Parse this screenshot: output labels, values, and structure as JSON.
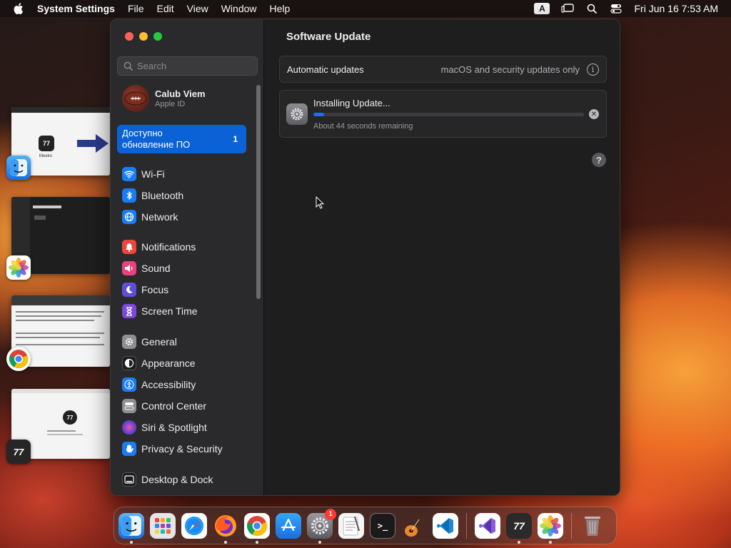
{
  "menubar": {
    "app_name": "System Settings",
    "items": [
      "File",
      "Edit",
      "View",
      "Window",
      "Help"
    ],
    "input_source": "A",
    "clock": "Fri Jun 16  7:53 AM"
  },
  "stage_manager": {
    "thumb1_caption": "Meeko"
  },
  "window": {
    "search": {
      "placeholder": "Search",
      "value": ""
    },
    "account": {
      "name": "Calub Viem",
      "subtitle": "Apple ID"
    },
    "update_banner": {
      "label": "Доступно обновление ПО",
      "count": "1"
    },
    "sidebar": {
      "group1": [
        {
          "label": "Wi-Fi",
          "icon": "wifi-icon",
          "color": "#1a7df5"
        },
        {
          "label": "Bluetooth",
          "icon": "bluetooth-icon",
          "color": "#1a7df5"
        },
        {
          "label": "Network",
          "icon": "globe-icon",
          "color": "#1a7df5"
        }
      ],
      "group2": [
        {
          "label": "Notifications",
          "icon": "bell-icon",
          "color": "#f0453a"
        },
        {
          "label": "Sound",
          "icon": "speaker-icon",
          "color": "#e8447a"
        },
        {
          "label": "Focus",
          "icon": "moon-icon",
          "color": "#5e4fd8"
        },
        {
          "label": "Screen Time",
          "icon": "hourglass-icon",
          "color": "#7d4ad8"
        }
      ],
      "group3": [
        {
          "label": "General",
          "icon": "gear-icon",
          "color": "#8e8e93"
        },
        {
          "label": "Appearance",
          "icon": "appearance-icon",
          "color": "#1c1c1e"
        },
        {
          "label": "Accessibility",
          "icon": "accessibility-icon",
          "color": "#1a7df5"
        },
        {
          "label": "Control Center",
          "icon": "control-center-icon",
          "color": "#8e8e93"
        },
        {
          "label": "Siri & Spotlight",
          "icon": "siri-icon",
          "color": "#c2369b"
        },
        {
          "label": "Privacy & Security",
          "icon": "hand-icon",
          "color": "#1a7df5"
        }
      ],
      "group4": [
        {
          "label": "Desktop & Dock",
          "icon": "dock-icon",
          "color": "#1c1c1e"
        }
      ]
    },
    "main": {
      "title": "Software Update",
      "automatic_updates": {
        "label": "Automatic updates",
        "value": "macOS and security updates only"
      },
      "install": {
        "title": "Installing Update...",
        "remaining": "About 44 seconds remaining",
        "progress_percent": 4
      }
    }
  },
  "dock": {
    "settings_badge": "1"
  },
  "colors": {
    "accent": "#0a62d6",
    "progress": "#1d6ff2"
  }
}
